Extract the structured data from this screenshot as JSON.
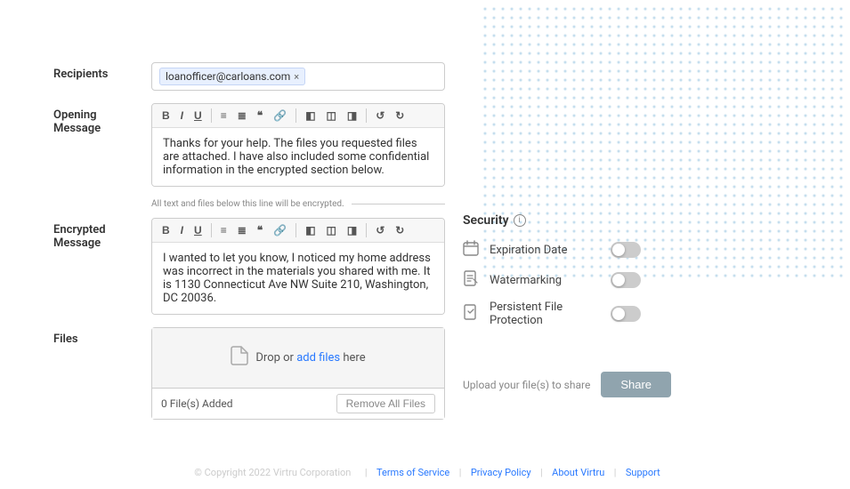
{
  "dotPattern": {
    "color": "#3a8fc7",
    "opacity": 0.35
  },
  "recipients": {
    "label": "Recipients",
    "email": "loanofficer@carloans.com",
    "closeSymbol": "×"
  },
  "openingMessage": {
    "label": "Opening\nMessage",
    "toolbar": [
      "B",
      "I",
      "U",
      "list",
      "olist",
      "quote",
      "link",
      "alignL",
      "alignC",
      "alignR",
      "undo",
      "redo"
    ],
    "body": "Thanks for your help. The files you requested files are attached. I have also included some confidential information in the encrypted section below."
  },
  "divider": {
    "text": "All text and files below this line will be encrypted."
  },
  "encryptedMessage": {
    "label": "Encrypted\nMessage",
    "body": "I wanted to let you know, I noticed my home address was incorrect in the materials you shared with me. It is 1130 Connecticut Ave NW Suite 210, Washington, DC 20036."
  },
  "files": {
    "label": "Files",
    "dropText": "Drop or",
    "dropLink": "add files",
    "dropTextAfter": "here",
    "count": "0 File(s) Added",
    "removeAll": "Remove All Files"
  },
  "security": {
    "title": "Security",
    "items": [
      {
        "id": "expiration",
        "label": "Expiration Date",
        "icon": "calendar",
        "enabled": false
      },
      {
        "id": "watermarking",
        "label": "Watermarking",
        "icon": "doc-water",
        "enabled": false
      },
      {
        "id": "persistent",
        "label": "Persistent File Protection",
        "icon": "doc-shield",
        "enabled": false
      }
    ]
  },
  "shareArea": {
    "uploadText": "Upload your file(s) to share",
    "shareButton": "Share"
  },
  "footer": {
    "copyright": "© Copyright 2022 Virtru Corporation",
    "links": [
      "Terms of Service",
      "Privacy Policy",
      "About Virtru",
      "Support"
    ]
  }
}
